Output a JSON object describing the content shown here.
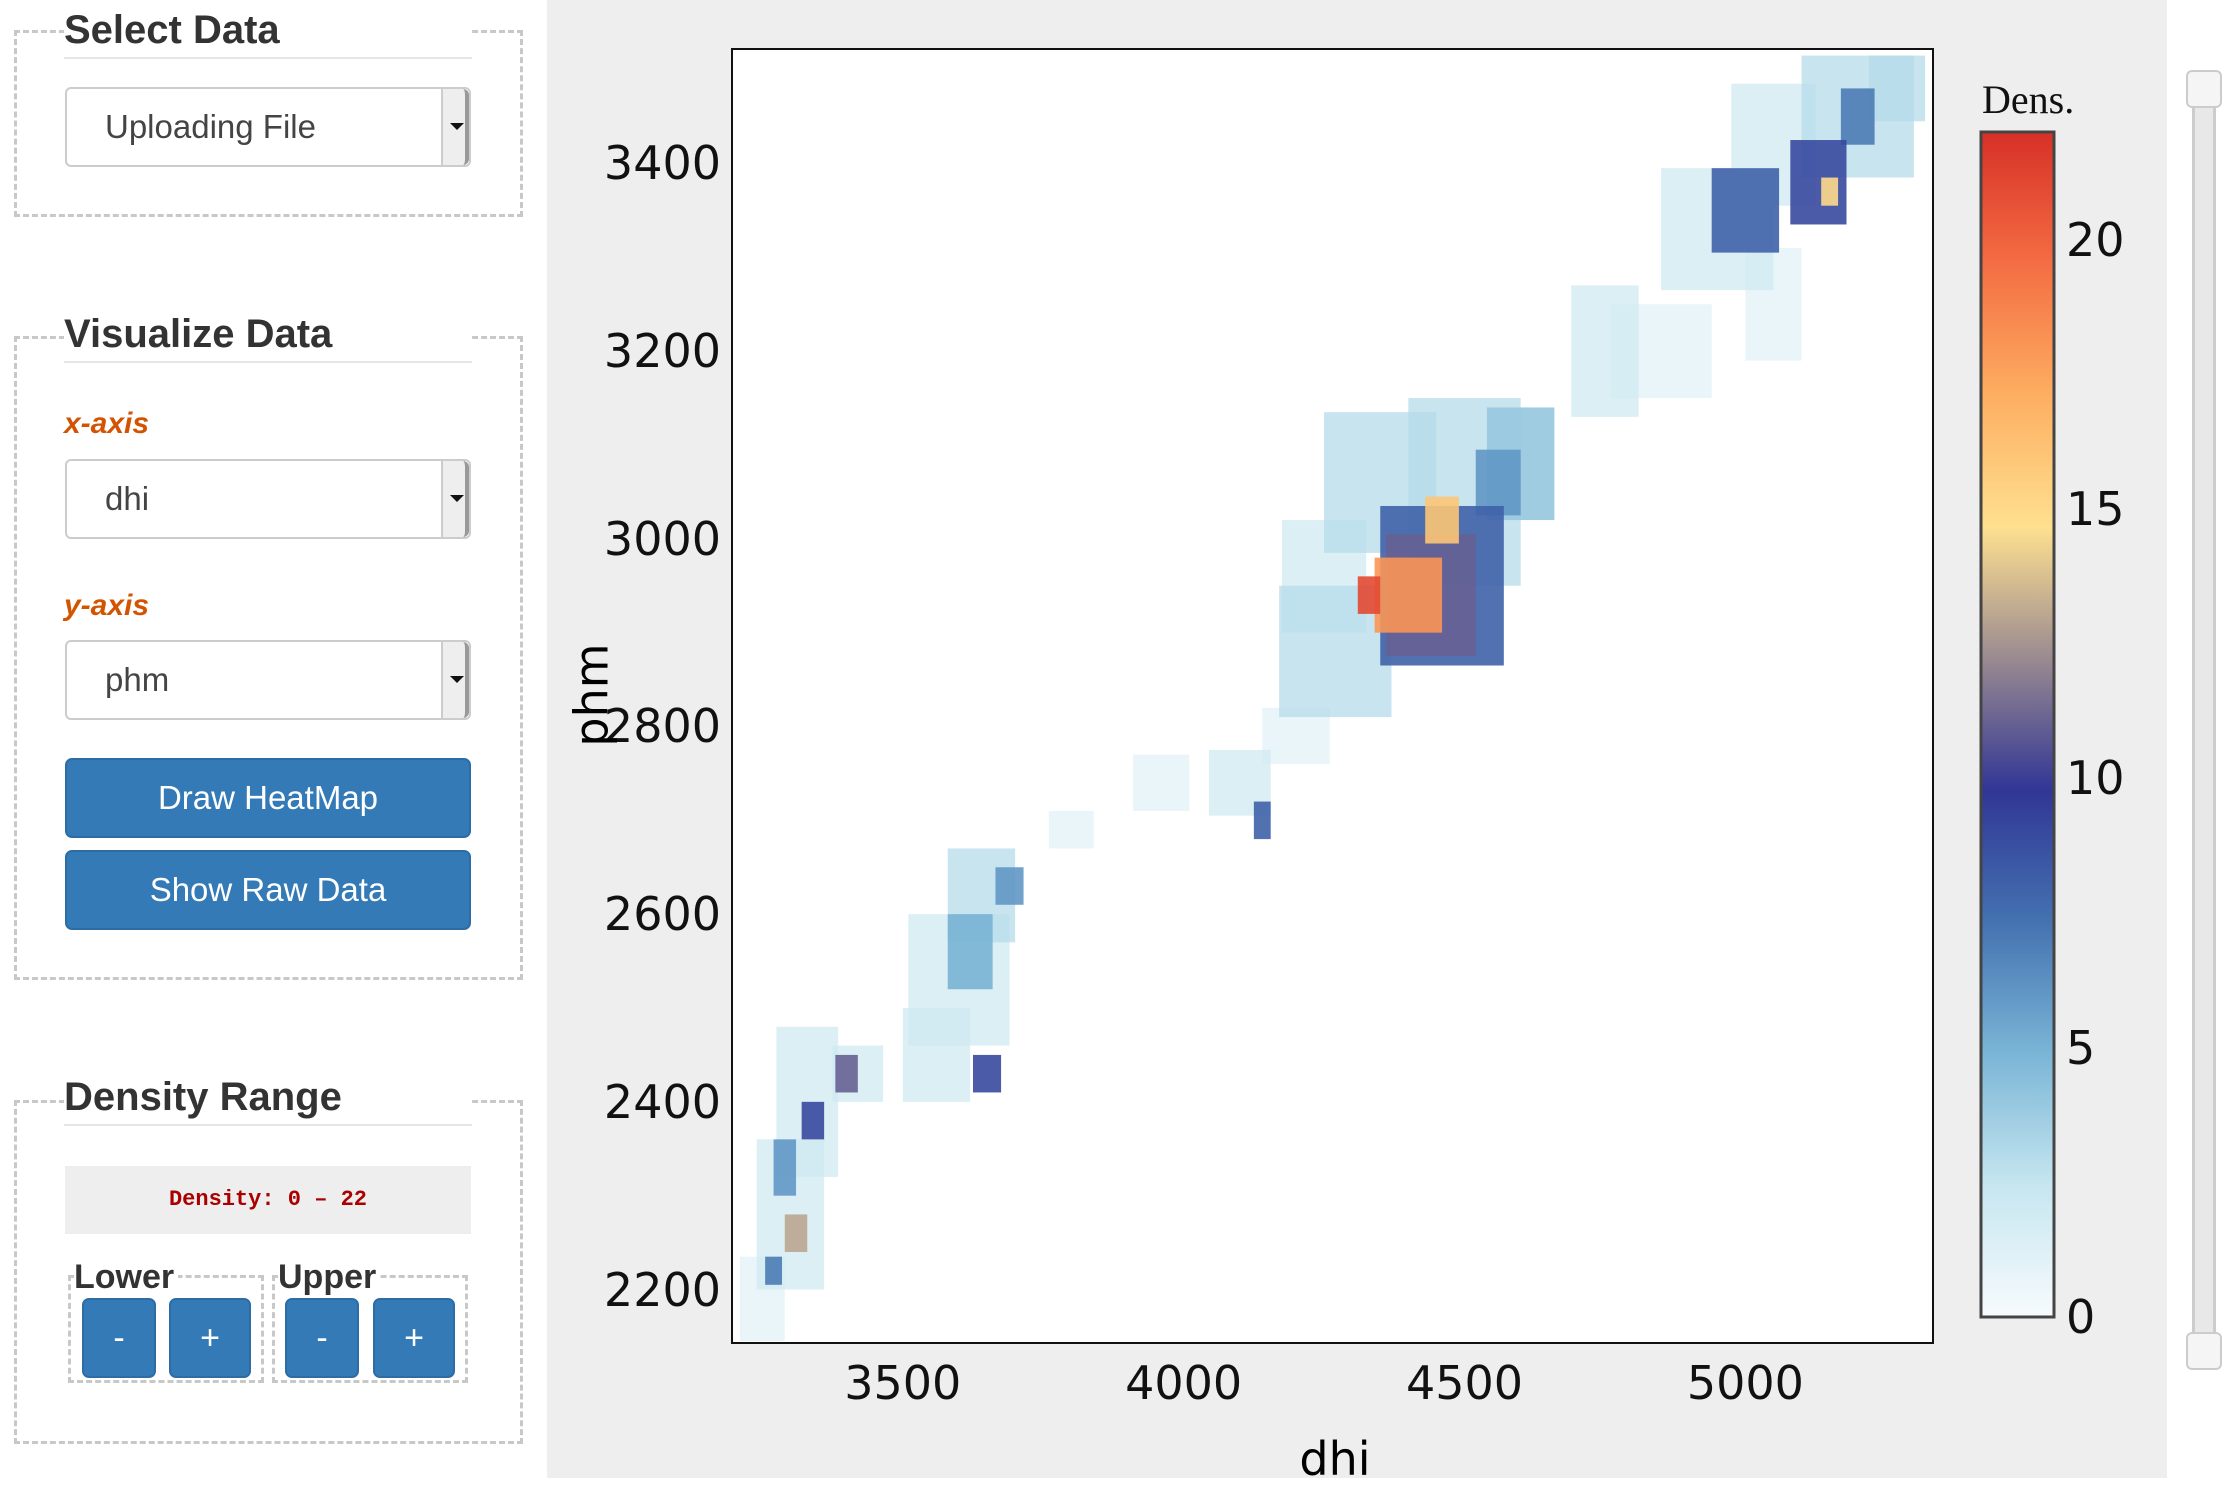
{
  "sidebar": {
    "select_data": {
      "title": "Select Data",
      "selected": "Uploading File"
    },
    "visualize": {
      "title": "Visualize Data",
      "x_label": "x-axis",
      "x_selected": "dhi",
      "y_label": "y-axis",
      "y_selected": "phm",
      "draw_button": "Draw HeatMap",
      "raw_button": "Show Raw Data"
    },
    "density": {
      "title": "Density Range",
      "display": "Density: 0 – 22",
      "lower": "Lower",
      "upper": "Upper",
      "minus": "-",
      "plus": "+"
    }
  },
  "chart_data": {
    "type": "heatmap",
    "xlabel": "dhi",
    "ylabel": "phm",
    "xlim": [
      3196,
      5334
    ],
    "ylim": [
      2143,
      3522
    ],
    "xticks": [
      3500,
      4000,
      4500,
      5000
    ],
    "yticks": [
      2200,
      2400,
      2600,
      2800,
      3000,
      3200,
      3400
    ],
    "colorbar": {
      "title": "Dens.",
      "range": [
        0,
        22
      ],
      "ticks": [
        0,
        5,
        10,
        15,
        20
      ],
      "colors": [
        "#f7fbfd",
        "#c6e6f0",
        "#7ab5d6",
        "#4472b0",
        "#313695",
        "#9a8a90",
        "#fee090",
        "#fdae61",
        "#f46d43",
        "#d73027"
      ]
    },
    "cells_note_format": "[x, y, width, height, density]",
    "cells": [
      [
        3250,
        2190,
        80,
        90,
        1
      ],
      [
        3300,
        2280,
        120,
        160,
        2
      ],
      [
        3330,
        2400,
        110,
        160,
        2
      ],
      [
        3420,
        2430,
        90,
        60,
        2
      ],
      [
        3560,
        2450,
        120,
        100,
        2
      ],
      [
        3600,
        2530,
        180,
        140,
        2
      ],
      [
        3640,
        2620,
        120,
        100,
        3
      ],
      [
        3800,
        2690,
        80,
        40,
        1
      ],
      [
        3960,
        2740,
        100,
        60,
        1
      ],
      [
        4100,
        2740,
        110,
        70,
        2
      ],
      [
        4200,
        2790,
        120,
        60,
        1
      ],
      [
        4270,
        2880,
        200,
        140,
        3
      ],
      [
        4250,
        2960,
        150,
        120,
        2
      ],
      [
        4350,
        3060,
        200,
        150,
        3
      ],
      [
        4500,
        3050,
        200,
        200,
        3
      ],
      [
        4600,
        3080,
        120,
        120,
        4
      ],
      [
        4750,
        3200,
        120,
        140,
        2
      ],
      [
        4850,
        3200,
        180,
        100,
        1
      ],
      [
        4950,
        3330,
        200,
        130,
        2
      ],
      [
        5050,
        3250,
        100,
        120,
        1
      ],
      [
        5050,
        3420,
        150,
        130,
        2
      ],
      [
        5200,
        3450,
        200,
        130,
        3
      ],
      [
        5270,
        3480,
        100,
        70,
        3
      ],
      [
        3290,
        2330,
        40,
        60,
        6
      ],
      [
        3340,
        2380,
        40,
        40,
        9
      ],
      [
        3400,
        2430,
        40,
        40,
        11
      ],
      [
        3310,
        2260,
        40,
        40,
        13
      ],
      [
        3270,
        2220,
        30,
        30,
        7
      ],
      [
        3650,
        2430,
        50,
        40,
        9
      ],
      [
        3620,
        2560,
        80,
        80,
        5
      ],
      [
        3690,
        2630,
        50,
        40,
        6
      ],
      [
        4140,
        2700,
        30,
        40,
        8
      ],
      [
        4460,
        2950,
        220,
        170,
        8
      ],
      [
        4440,
        2940,
        160,
        130,
        11
      ],
      [
        4400,
        2940,
        120,
        80,
        18
      ],
      [
        4330,
        2940,
        40,
        40,
        21
      ],
      [
        4460,
        3020,
        60,
        50,
        16
      ],
      [
        4560,
        3060,
        80,
        70,
        6
      ],
      [
        5000,
        3350,
        120,
        90,
        8
      ],
      [
        5130,
        3380,
        100,
        90,
        9
      ],
      [
        5150,
        3370,
        30,
        30,
        15
      ],
      [
        5200,
        3450,
        60,
        60,
        7
      ]
    ]
  }
}
